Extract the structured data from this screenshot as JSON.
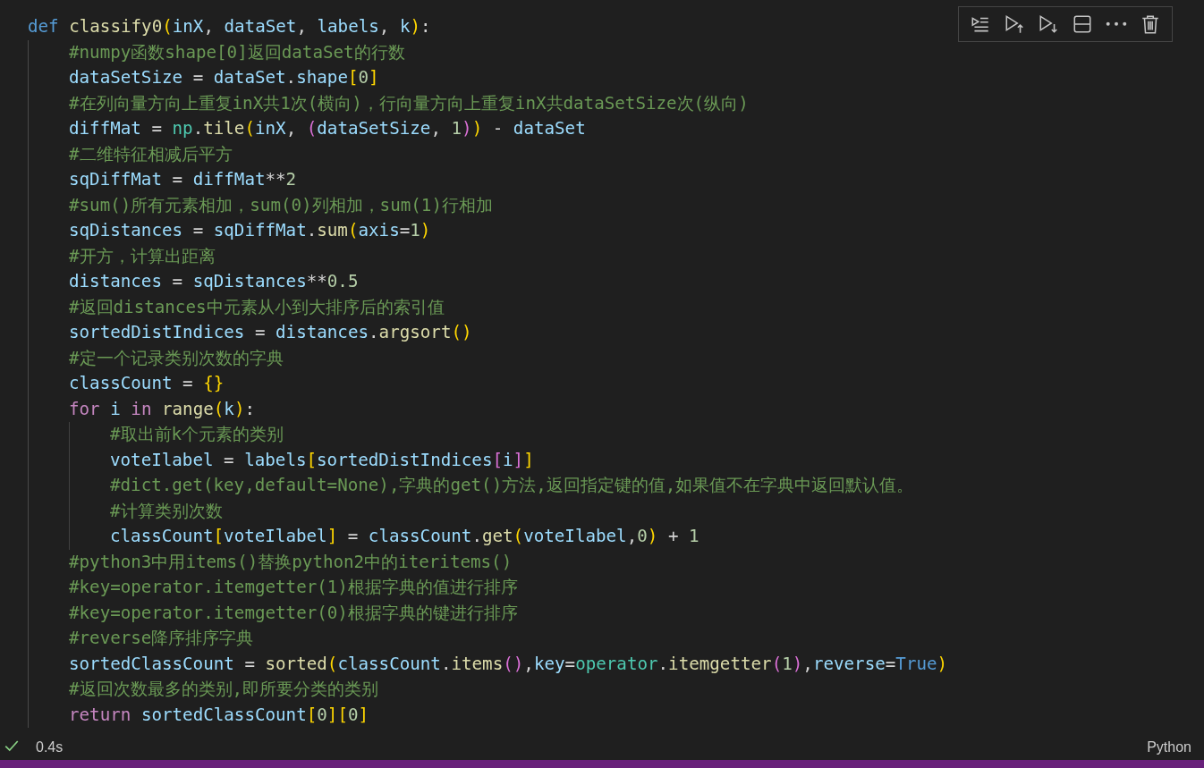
{
  "cell_toolbar": [
    {
      "kind": "run-by-line"
    },
    {
      "kind": "run-above"
    },
    {
      "kind": "run-below"
    },
    {
      "kind": "split"
    },
    {
      "kind": "more"
    },
    {
      "kind": "delete"
    }
  ],
  "code": [
    {
      "tokens": [
        {
          "kind": "kw",
          "text": "def "
        },
        {
          "kind": "fn",
          "text": "classify0"
        },
        {
          "kind": "b1",
          "text": "("
        },
        {
          "kind": "var",
          "text": "inX"
        },
        {
          "kind": "op",
          "text": ", "
        },
        {
          "kind": "var",
          "text": "dataSet"
        },
        {
          "kind": "op",
          "text": ", "
        },
        {
          "kind": "var",
          "text": "labels"
        },
        {
          "kind": "op",
          "text": ", "
        },
        {
          "kind": "var",
          "text": "k"
        },
        {
          "kind": "b1",
          "text": ")"
        },
        {
          "kind": "op",
          "text": ":"
        }
      ],
      "children": [
        {
          "tokens": [
            {
              "kind": "cm",
              "text": "#numpy函数shape[0]返回dataSet的行数"
            }
          ]
        },
        {
          "tokens": [
            {
              "kind": "var",
              "text": "dataSetSize"
            },
            {
              "kind": "op",
              "text": " = "
            },
            {
              "kind": "var",
              "text": "dataSet"
            },
            {
              "kind": "op",
              "text": "."
            },
            {
              "kind": "var",
              "text": "shape"
            },
            {
              "kind": "b1",
              "text": "["
            },
            {
              "kind": "num",
              "text": "0"
            },
            {
              "kind": "b1",
              "text": "]"
            }
          ]
        },
        {
          "tokens": [
            {
              "kind": "cm",
              "text": "#在列向量方向上重复inX共1次(横向)，行向量方向上重复inX共dataSetSize次(纵向)"
            }
          ]
        },
        {
          "tokens": [
            {
              "kind": "var",
              "text": "diffMat"
            },
            {
              "kind": "op",
              "text": " = "
            },
            {
              "kind": "mod",
              "text": "np"
            },
            {
              "kind": "op",
              "text": "."
            },
            {
              "kind": "fn",
              "text": "tile"
            },
            {
              "kind": "b1",
              "text": "("
            },
            {
              "kind": "var",
              "text": "inX"
            },
            {
              "kind": "op",
              "text": ", "
            },
            {
              "kind": "b2",
              "text": "("
            },
            {
              "kind": "var",
              "text": "dataSetSize"
            },
            {
              "kind": "op",
              "text": ", "
            },
            {
              "kind": "num",
              "text": "1"
            },
            {
              "kind": "b2",
              "text": ")"
            },
            {
              "kind": "b1",
              "text": ")"
            },
            {
              "kind": "op",
              "text": " - "
            },
            {
              "kind": "var",
              "text": "dataSet"
            }
          ]
        },
        {
          "tokens": [
            {
              "kind": "cm",
              "text": "#二维特征相减后平方"
            }
          ]
        },
        {
          "tokens": [
            {
              "kind": "var",
              "text": "sqDiffMat"
            },
            {
              "kind": "op",
              "text": " = "
            },
            {
              "kind": "var",
              "text": "diffMat"
            },
            {
              "kind": "op",
              "text": "**"
            },
            {
              "kind": "num",
              "text": "2"
            }
          ]
        },
        {
          "tokens": [
            {
              "kind": "cm",
              "text": "#sum()所有元素相加，sum(0)列相加，sum(1)行相加"
            }
          ]
        },
        {
          "tokens": [
            {
              "kind": "var",
              "text": "sqDistances"
            },
            {
              "kind": "op",
              "text": " = "
            },
            {
              "kind": "var",
              "text": "sqDiffMat"
            },
            {
              "kind": "op",
              "text": "."
            },
            {
              "kind": "fn",
              "text": "sum"
            },
            {
              "kind": "b1",
              "text": "("
            },
            {
              "kind": "var",
              "text": "axis"
            },
            {
              "kind": "op",
              "text": "="
            },
            {
              "kind": "num",
              "text": "1"
            },
            {
              "kind": "b1",
              "text": ")"
            }
          ]
        },
        {
          "tokens": [
            {
              "kind": "cm",
              "text": "#开方，计算出距离"
            }
          ]
        },
        {
          "tokens": [
            {
              "kind": "var",
              "text": "distances"
            },
            {
              "kind": "op",
              "text": " = "
            },
            {
              "kind": "var",
              "text": "sqDistances"
            },
            {
              "kind": "op",
              "text": "**"
            },
            {
              "kind": "num",
              "text": "0.5"
            }
          ]
        },
        {
          "tokens": [
            {
              "kind": "cm",
              "text": "#返回distances中元素从小到大排序后的索引值"
            }
          ]
        },
        {
          "tokens": [
            {
              "kind": "var",
              "text": "sortedDistIndices"
            },
            {
              "kind": "op",
              "text": " = "
            },
            {
              "kind": "var",
              "text": "distances"
            },
            {
              "kind": "op",
              "text": "."
            },
            {
              "kind": "fn",
              "text": "argsort"
            },
            {
              "kind": "b1",
              "text": "()"
            }
          ]
        },
        {
          "tokens": [
            {
              "kind": "cm",
              "text": "#定一个记录类别次数的字典"
            }
          ]
        },
        {
          "tokens": [
            {
              "kind": "var",
              "text": "classCount"
            },
            {
              "kind": "op",
              "text": " = "
            },
            {
              "kind": "b1",
              "text": "{}"
            }
          ]
        },
        {
          "tokens": [
            {
              "kind": "ctrl",
              "text": "for "
            },
            {
              "kind": "var",
              "text": "i "
            },
            {
              "kind": "ctrl",
              "text": "in "
            },
            {
              "kind": "fn",
              "text": "range"
            },
            {
              "kind": "b1",
              "text": "("
            },
            {
              "kind": "var",
              "text": "k"
            },
            {
              "kind": "b1",
              "text": ")"
            },
            {
              "kind": "op",
              "text": ":"
            }
          ],
          "children": [
            {
              "tokens": [
                {
                  "kind": "cm",
                  "text": "#取出前k个元素的类别"
                }
              ]
            },
            {
              "tokens": [
                {
                  "kind": "var",
                  "text": "voteIlabel"
                },
                {
                  "kind": "op",
                  "text": " = "
                },
                {
                  "kind": "var",
                  "text": "labels"
                },
                {
                  "kind": "b1",
                  "text": "["
                },
                {
                  "kind": "var",
                  "text": "sortedDistIndices"
                },
                {
                  "kind": "b2",
                  "text": "["
                },
                {
                  "kind": "var",
                  "text": "i"
                },
                {
                  "kind": "b2",
                  "text": "]"
                },
                {
                  "kind": "b1",
                  "text": "]"
                }
              ]
            },
            {
              "tokens": [
                {
                  "kind": "cm",
                  "text": "#dict.get(key,default=None),字典的get()方法,返回指定键的值,如果值不在字典中返回默认值。"
                }
              ]
            },
            {
              "tokens": [
                {
                  "kind": "cm",
                  "text": "#计算类别次数"
                }
              ]
            },
            {
              "tokens": [
                {
                  "kind": "var",
                  "text": "classCount"
                },
                {
                  "kind": "b1",
                  "text": "["
                },
                {
                  "kind": "var",
                  "text": "voteIlabel"
                },
                {
                  "kind": "b1",
                  "text": "]"
                },
                {
                  "kind": "op",
                  "text": " = "
                },
                {
                  "kind": "var",
                  "text": "classCount"
                },
                {
                  "kind": "op",
                  "text": "."
                },
                {
                  "kind": "fn",
                  "text": "get"
                },
                {
                  "kind": "b1",
                  "text": "("
                },
                {
                  "kind": "var",
                  "text": "voteIlabel"
                },
                {
                  "kind": "op",
                  "text": ","
                },
                {
                  "kind": "num",
                  "text": "0"
                },
                {
                  "kind": "b1",
                  "text": ")"
                },
                {
                  "kind": "op",
                  "text": " + "
                },
                {
                  "kind": "num",
                  "text": "1"
                }
              ]
            }
          ]
        },
        {
          "tokens": [
            {
              "kind": "cm",
              "text": "#python3中用items()替换python2中的iteritems()"
            }
          ]
        },
        {
          "tokens": [
            {
              "kind": "cm",
              "text": "#key=operator.itemgetter(1)根据字典的值进行排序"
            }
          ]
        },
        {
          "tokens": [
            {
              "kind": "cm",
              "text": "#key=operator.itemgetter(0)根据字典的键进行排序"
            }
          ]
        },
        {
          "tokens": [
            {
              "kind": "cm",
              "text": "#reverse降序排序字典"
            }
          ]
        },
        {
          "tokens": [
            {
              "kind": "var",
              "text": "sortedClassCount"
            },
            {
              "kind": "op",
              "text": " = "
            },
            {
              "kind": "fn",
              "text": "sorted"
            },
            {
              "kind": "b1",
              "text": "("
            },
            {
              "kind": "var",
              "text": "classCount"
            },
            {
              "kind": "op",
              "text": "."
            },
            {
              "kind": "fn",
              "text": "items"
            },
            {
              "kind": "b2",
              "text": "()"
            },
            {
              "kind": "op",
              "text": ","
            },
            {
              "kind": "var",
              "text": "key"
            },
            {
              "kind": "op",
              "text": "="
            },
            {
              "kind": "mod",
              "text": "operator"
            },
            {
              "kind": "op",
              "text": "."
            },
            {
              "kind": "fn",
              "text": "itemgetter"
            },
            {
              "kind": "b2",
              "text": "("
            },
            {
              "kind": "num",
              "text": "1"
            },
            {
              "kind": "b2",
              "text": ")"
            },
            {
              "kind": "op",
              "text": ","
            },
            {
              "kind": "var",
              "text": "reverse"
            },
            {
              "kind": "op",
              "text": "="
            },
            {
              "kind": "kw",
              "text": "True"
            },
            {
              "kind": "b1",
              "text": ")"
            }
          ]
        },
        {
          "tokens": [
            {
              "kind": "cm",
              "text": "#返回次数最多的类别,即所要分类的类别"
            }
          ]
        },
        {
          "tokens": [
            {
              "kind": "ctrl",
              "text": "return "
            },
            {
              "kind": "var",
              "text": "sortedClassCount"
            },
            {
              "kind": "b1",
              "text": "["
            },
            {
              "kind": "num",
              "text": "0"
            },
            {
              "kind": "b1",
              "text": "]"
            },
            {
              "kind": "b1",
              "text": "["
            },
            {
              "kind": "num",
              "text": "0"
            },
            {
              "kind": "b1",
              "text": "]"
            }
          ]
        }
      ]
    }
  ],
  "execution": {
    "succeeded": true,
    "duration": "0.4s"
  },
  "language": "Python"
}
